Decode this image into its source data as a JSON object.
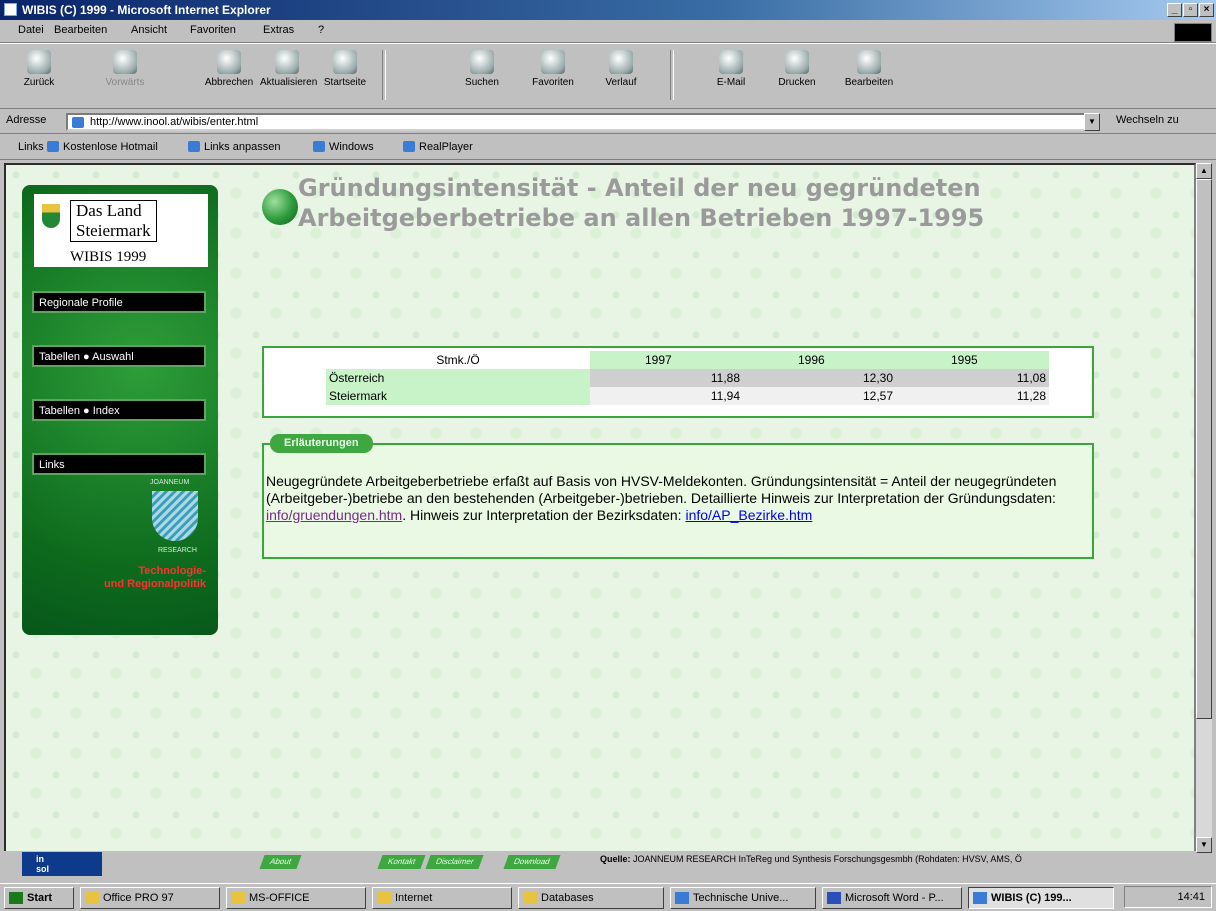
{
  "window": {
    "title": "WIBIS (C) 1999 - Microsoft Internet Explorer"
  },
  "menu": [
    "Datei",
    "Bearbeiten",
    "Ansicht",
    "Favoriten",
    "Extras",
    "?"
  ],
  "toolbar": {
    "back": "Zurück",
    "forward": "Vorwärts",
    "stop": "Abbrechen",
    "refresh": "Aktualisieren",
    "home": "Startseite",
    "search": "Suchen",
    "favorites": "Favoriten",
    "history": "Verlauf",
    "mail": "E-Mail",
    "print": "Drucken",
    "edit": "Bearbeiten"
  },
  "address": {
    "label": "Adresse",
    "url": "http://www.inool.at/wibis/enter.html",
    "go": "Wechseln zu"
  },
  "links": {
    "label": "Links",
    "items": [
      "Kostenlose Hotmail",
      "Links anpassen",
      "Windows",
      "RealPlayer"
    ]
  },
  "sidebar": {
    "logo_line1": "Das Land",
    "logo_line2": "Steiermark",
    "logo_wibis": "WIBIS 1999",
    "nav": [
      "Regionale Profile",
      "Tabellen ● Auswahl",
      "Tabellen ● Index",
      "Links"
    ],
    "jr_top": "JOANNEUM",
    "jr_bottom": "RESEARCH",
    "tech_line1": "Technologie-",
    "tech_line2": "und Regionalpolitik"
  },
  "page": {
    "heading_line1": "Gründungsintensität - Anteil der neu gegründeten",
    "heading_line2": "Arbeitgeberbetriebe an allen Betrieben 1997-1995"
  },
  "table": {
    "header_label": "Stmk./Ö",
    "years": [
      "1997",
      "1996",
      "1995"
    ],
    "rows": [
      {
        "label": "Österreich",
        "values": [
          "11,88",
          "12,30",
          "11,08"
        ]
      },
      {
        "label": "Steiermark",
        "values": [
          "11,94",
          "12,57",
          "11,28"
        ]
      }
    ]
  },
  "explanation": {
    "tab": "Erläuterungen",
    "text1": "Neugegründete Arbeitgeberbetriebe erfaßt auf Basis von HVSV-Meldekonten. Gründungsintensität = Anteil der neugegründeten (Arbeitgeber-)betriebe an den bestehenden (Arbeitgeber-)betrieben. Detaillierte Hinweis zur Interpretation der Gründungsdaten: ",
    "link1": "info/gruendungen.htm",
    "text2": ". Hinweis zur Interpretation der Bezirksdaten: ",
    "link2": "info/AP_Bezirke.htm"
  },
  "bottom": {
    "brand_top": "in",
    "brand_bottom": "sol",
    "tab_about": "About",
    "tab_kontakt": "Kontakt",
    "tab_disclaimer": "Disclaimer",
    "tab_download": "Download",
    "quelle_label": "Quelle:",
    "quelle_text": "JOANNEUM RESEARCH InTeReg und Synthesis Forschungsgesmbh (Rohdaten: HVSV, AMS, Ö"
  },
  "taskbar": {
    "start": "Start",
    "tasks": [
      "Office PRO 97",
      "MS-OFFICE",
      "Internet",
      "Databases",
      "Technische Unive...",
      "Microsoft Word - P...",
      "WIBIS (C) 199..."
    ],
    "time": "14:41"
  }
}
